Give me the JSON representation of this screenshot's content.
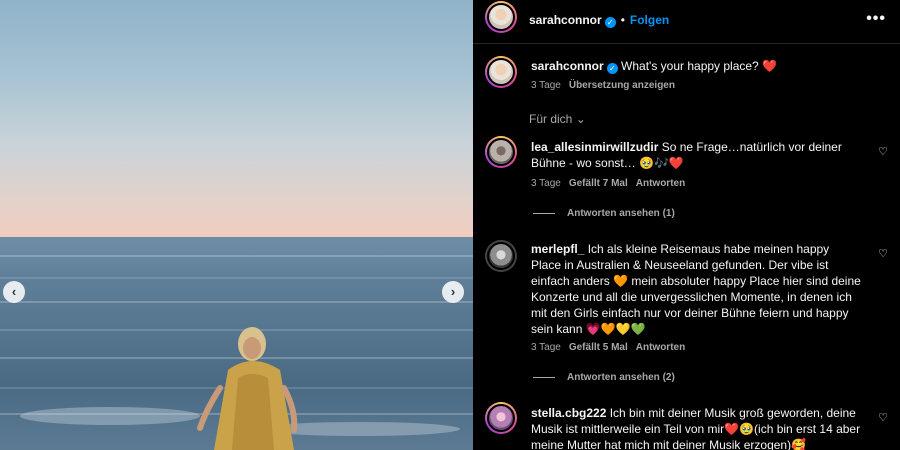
{
  "post": {
    "nav_prev": "‹",
    "nav_next": "›"
  },
  "header": {
    "username": "sarahconnor",
    "verified": "✓",
    "separator": "•",
    "follow_label": "Folgen",
    "more": "•••"
  },
  "caption": {
    "username": "sarahconnor",
    "verified": "✓",
    "text": "What's your happy place? ❤️",
    "time": "3 Tage",
    "translate": "Übersetzung anzeigen"
  },
  "filter": {
    "label": "Für dich",
    "chevron": "⌄"
  },
  "comments": [
    {
      "username": "lea_allesinmirwillzudir",
      "text": "So ne Frage…natürlich vor deiner Bühne - wo sonst… 🥹🎶❤️",
      "time": "3 Tage",
      "likes": "Gefällt 7 Mal",
      "reply": "Antworten",
      "view_replies": "Antworten ansehen (1)",
      "heart": "♡"
    },
    {
      "username": "merlepfl_",
      "text": "Ich als kleine Reisemaus habe meinen happy Place in Australien & Neuseeland gefunden. Der vibe ist einfach anders 🧡 mein absoluter happy Place hier sind deine Konzerte und all die unvergesslichen Momente, in denen ich mit den Girls einfach nur vor deiner Bühne feiern und happy sein kann 💗🧡💛💚",
      "time": "3 Tage",
      "likes": "Gefällt 5 Mal",
      "reply": "Antworten",
      "view_replies": "Antworten ansehen (2)",
      "heart": "♡"
    },
    {
      "username": "stella.cbg222",
      "text": "Ich bin mit deiner Musik groß geworden, deine Musik ist mittlerweile ein Teil von mir❤️🥹(ich bin erst 14 aber meine Mutter hat mich mit deiner Musik erzogen)🥰",
      "heart": "♡"
    }
  ]
}
